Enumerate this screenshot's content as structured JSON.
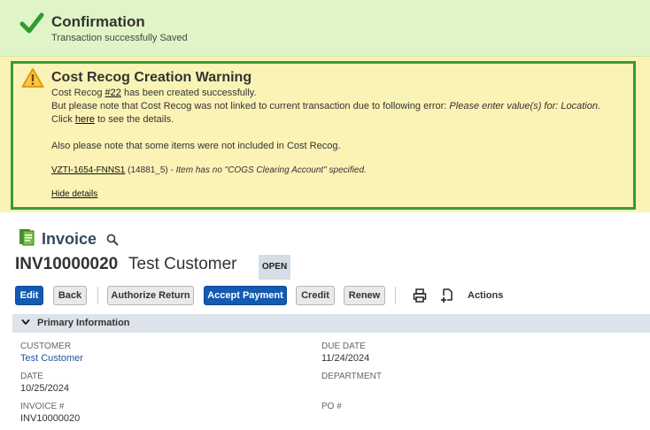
{
  "confirmation": {
    "title": "Confirmation",
    "message": "Transaction successfully Saved"
  },
  "warning": {
    "title": "Cost Recog Creation Warning",
    "line1_prefix": "Cost Recog ",
    "line1_link": "#22",
    "line1_suffix": " has been created successfully.",
    "line2_prefix": "But please note that Cost Recog was not linked to current transaction due to following error: ",
    "line2_error": "Please enter value(s) for: Location.",
    "line3_prefix": "Click ",
    "line3_link": "here",
    "line3_suffix": " to see the details.",
    "line4": "Also please note that some items were not included in Cost Recog.",
    "item_link": "VZTI-1654-FNNS1",
    "item_code": " (14881_5) - ",
    "item_note": "Item has no \"COGS Clearing Account\" specified.",
    "hide_details": "Hide details"
  },
  "record": {
    "type": "Invoice",
    "number": "INV10000020",
    "name": "Test Customer",
    "status": "OPEN"
  },
  "toolbar": {
    "edit": "Edit",
    "back": "Back",
    "authorize_return": "Authorize Return",
    "accept_payment": "Accept Payment",
    "credit": "Credit",
    "renew": "Renew",
    "actions": "Actions"
  },
  "section": {
    "title": "Primary Information"
  },
  "fields": {
    "customer_label": "CUSTOMER",
    "customer_value": "Test Customer",
    "date_label": "DATE",
    "date_value": "10/25/2024",
    "invoice_label": "INVOICE #",
    "invoice_value": "INV10000020",
    "due_date_label": "DUE DATE",
    "due_date_value": "11/24/2024",
    "department_label": "DEPARTMENT",
    "po_label": "PO #"
  },
  "colors": {
    "confirm_bg": "#dff5c7",
    "warning_bg": "#fbf3b5",
    "warning_border": "#3a9a3a",
    "primary_button": "#125ab2",
    "section_bg": "#dde3ea",
    "link": "#255599"
  },
  "icons": {
    "confirm": "check-icon",
    "warning": "warning-triangle-icon",
    "record": "invoice-document-icon",
    "search": "search-icon",
    "print": "print-icon",
    "new_window": "new-document-icon",
    "section_toggle": "chevron-down-icon"
  }
}
